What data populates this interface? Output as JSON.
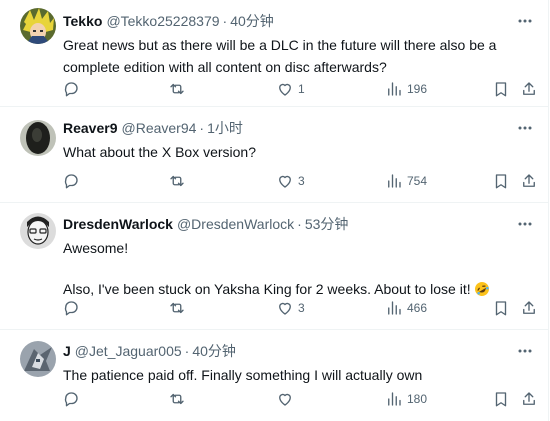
{
  "replies": [
    {
      "name": "Tekko",
      "handle": "@Tekko25228379",
      "time": "40分钟",
      "text": "Great news but as there will be a DLC in the future will there also be a complete edition with all content on disc afterwards?",
      "likes": "1",
      "views": "196",
      "avatar_icon": "anime-character-avatar"
    },
    {
      "name": "Reaver9",
      "handle": "@Reaver94",
      "time": "1小时",
      "text": "What about the X Box version?",
      "likes": "3",
      "views": "754",
      "avatar_icon": "dark-portrait-avatar"
    },
    {
      "name": "DresdenWarlock",
      "handle": "@DresdenWarlock",
      "time": "53分钟",
      "text_line1": "Awesome!",
      "text_line2": "Also, I've been stuck on Yaksha King for 2 weeks. About to lose it!",
      "emoji": "rolling-on-floor-laughing-emoji",
      "likes": "3",
      "views": "466",
      "avatar_icon": "sketch-portrait-avatar"
    },
    {
      "name": "J",
      "handle": "@Jet_Jaguar005",
      "time": "40分钟",
      "text": "The patience paid off. Finally something I will actually own",
      "likes": "",
      "views": "180",
      "avatar_icon": "mecha-avatar"
    }
  ],
  "separator": "·",
  "colors": {
    "text": "#0f1419",
    "secondary": "#536471",
    "border": "#eff3f4"
  }
}
